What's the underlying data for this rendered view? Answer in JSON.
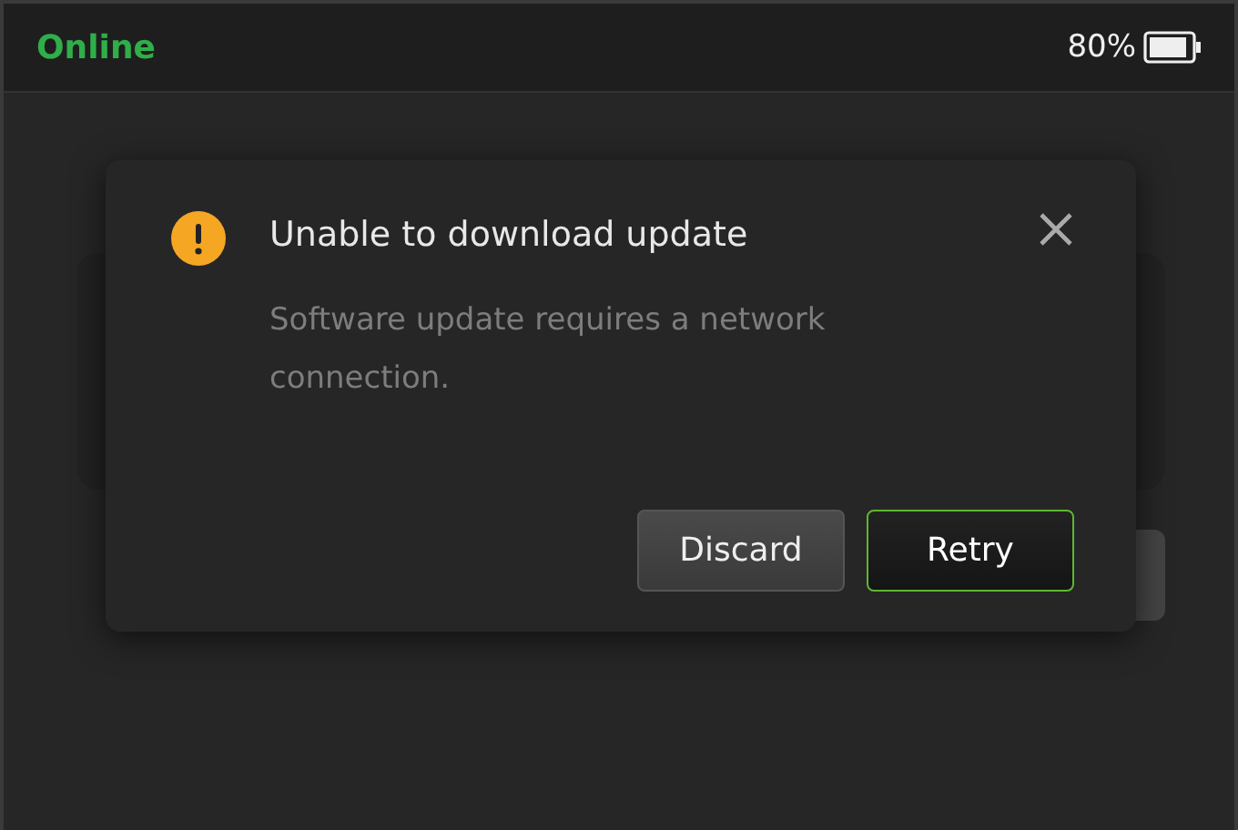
{
  "status_bar": {
    "connection": "Online",
    "battery": "80%"
  },
  "dialog": {
    "title": "Unable to download update",
    "message": "Software update requires a network connection.",
    "buttons": [
      {
        "label": "Discard",
        "kind": "secondary"
      },
      {
        "label": "Retry",
        "kind": "primary"
      }
    ]
  }
}
